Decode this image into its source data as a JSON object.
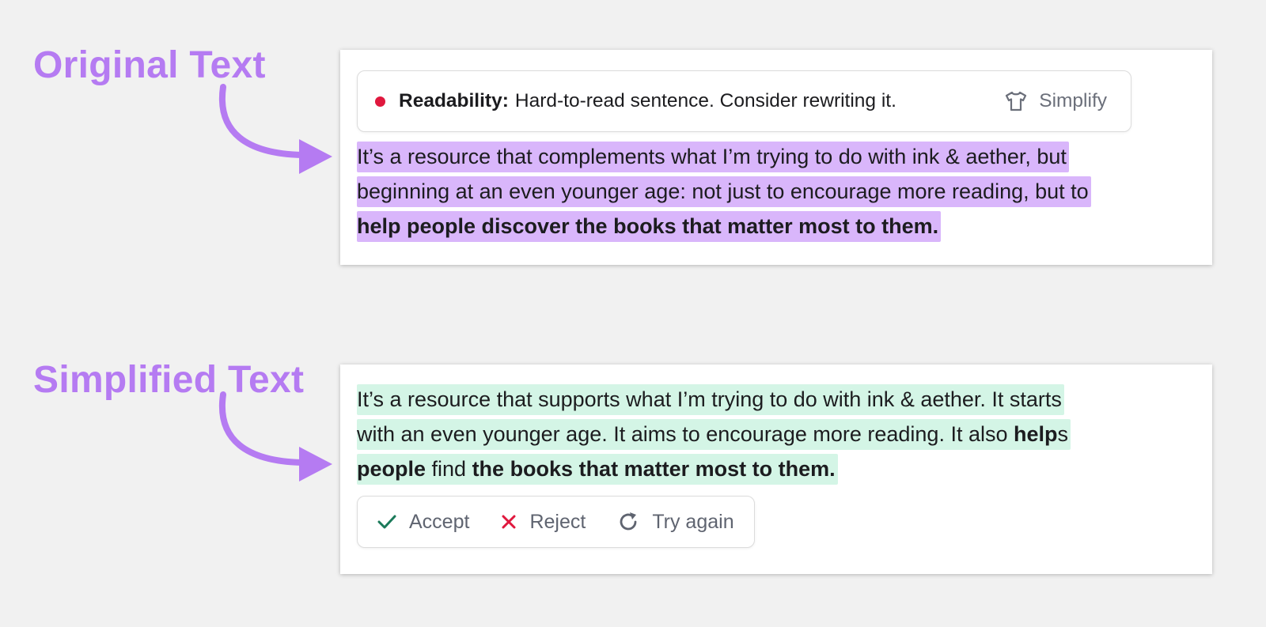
{
  "labels": {
    "original": "Original Text",
    "simplified": "Simplified Text"
  },
  "colors": {
    "label": "#b57bf2",
    "highlight_original": "#d9b6fb",
    "highlight_simplified": "#d4f5e6",
    "status_dot": "#e0183e",
    "accept_icon": "#1b7a5a",
    "reject_icon": "#e0183e"
  },
  "original_card": {
    "readability": {
      "title": "Readability:",
      "message": "Hard-to-read sentence. Consider rewriting it.",
      "status_icon": "red-dot-icon",
      "action_icon": "tshirt-icon",
      "action_label": "Simplify"
    },
    "paragraph": {
      "line1": "It’s a resource that complements what I’m trying to do with ink & aether, but",
      "line2": "beginning at an even younger age: not just to encourage more reading, but to",
      "line3_bold": "help people discover the books that matter most to them."
    }
  },
  "simplified_card": {
    "paragraph": {
      "line1": "It’s a resource that supports what I’m trying to do with ink & aether. It starts",
      "line2_a": "with an even younger age. It aims to encourage more reading. It also ",
      "line2_bold": "help",
      "line2_b": "s",
      "line3_bold_a": "people",
      "line3_b": " find ",
      "line3_bold_c": "the books that matter most to them."
    },
    "actions": {
      "accept": "Accept",
      "reject": "Reject",
      "try_again": "Try again",
      "accept_icon": "check-icon",
      "reject_icon": "x-icon",
      "try_again_icon": "refresh-icon"
    }
  }
}
